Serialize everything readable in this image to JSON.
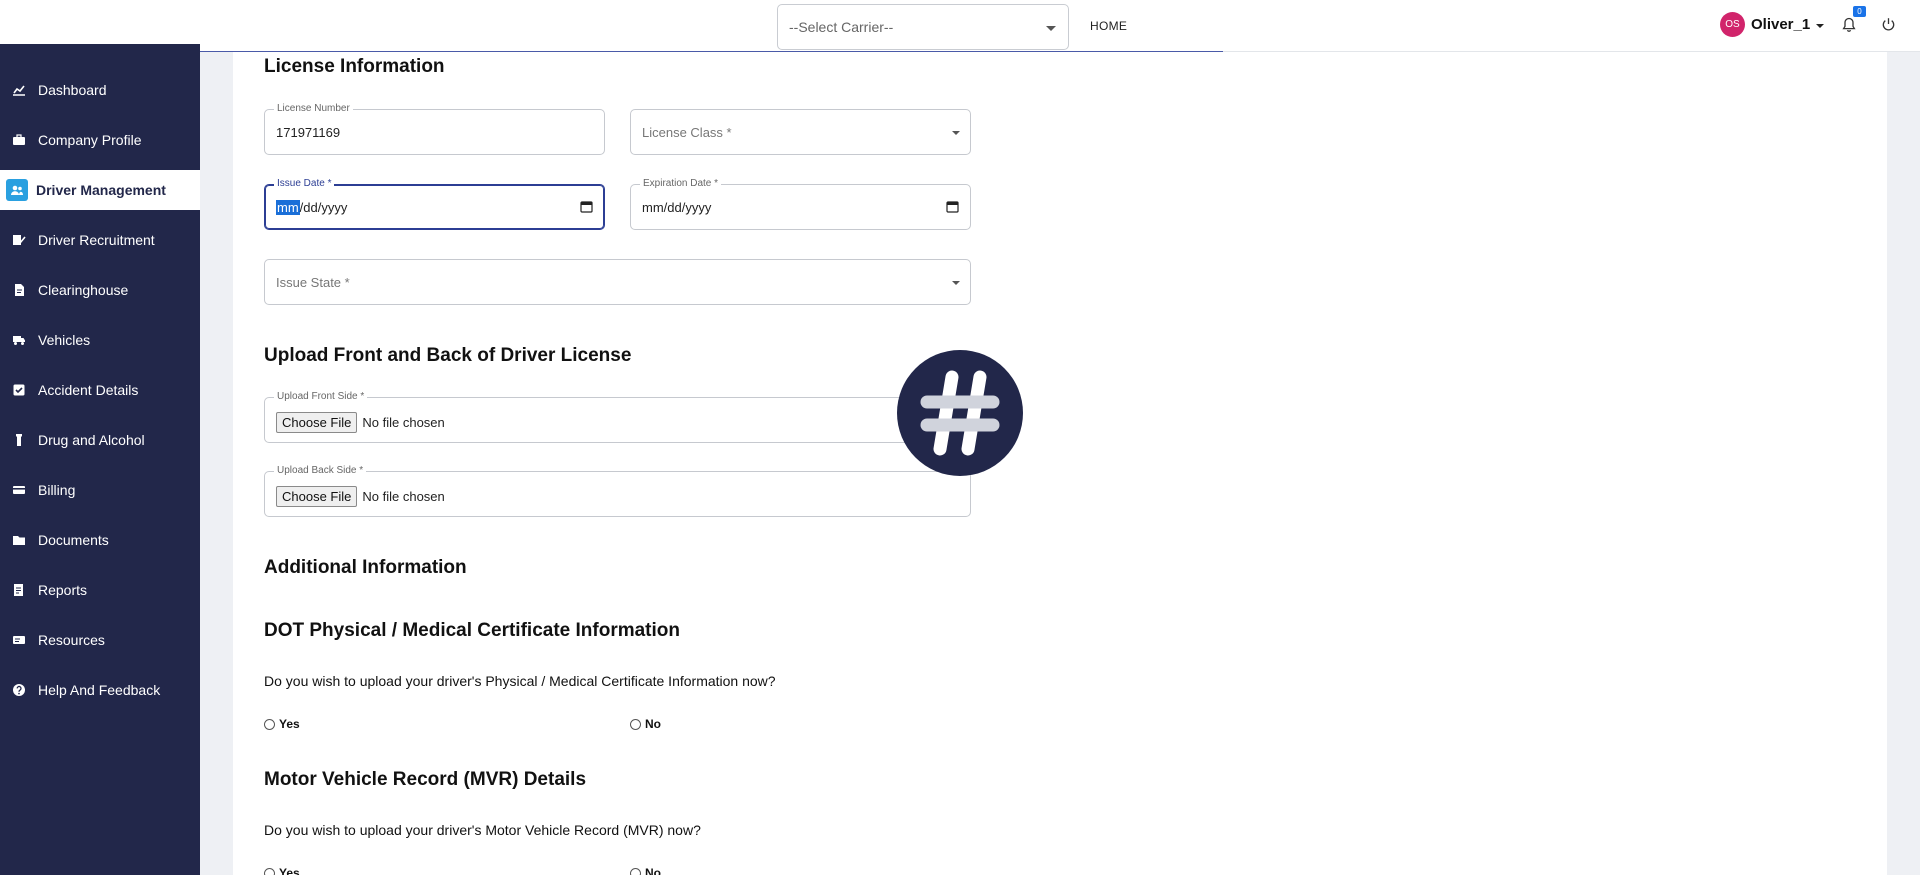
{
  "header": {
    "carrier_placeholder": "--Select Carrier--",
    "home_label": "HOME",
    "user_initials": "OS",
    "user_name": "Oliver_1",
    "notification_count": "0"
  },
  "sidebar": {
    "items": [
      {
        "label": "Dashboard",
        "icon": "chart-icon"
      },
      {
        "label": "Company Profile",
        "icon": "briefcase-icon"
      },
      {
        "label": "Driver Management",
        "icon": "users-icon",
        "active": true
      },
      {
        "label": "Driver Recruitment",
        "icon": "edit-icon"
      },
      {
        "label": "Clearinghouse",
        "icon": "document-icon"
      },
      {
        "label": "Vehicles",
        "icon": "truck-icon"
      },
      {
        "label": "Accident Details",
        "icon": "check-square-icon"
      },
      {
        "label": "Drug and Alcohol",
        "icon": "bottle-icon"
      },
      {
        "label": "Billing",
        "icon": "credit-card-icon"
      },
      {
        "label": "Documents",
        "icon": "folder-icon"
      },
      {
        "label": "Reports",
        "icon": "report-icon"
      },
      {
        "label": "Resources",
        "icon": "id-card-icon"
      },
      {
        "label": "Help And Feedback",
        "icon": "question-icon"
      }
    ]
  },
  "license": {
    "title": "License Information",
    "number_label": "License Number",
    "number_value": "171971169",
    "class_placeholder": "License Class *",
    "issue_date_label": "Issue Date *",
    "issue_date_mm": "mm",
    "issue_date_rest": "/dd/yyyy",
    "expiration_label": "Expiration Date *",
    "expiration_value": "mm/dd/yyyy",
    "state_placeholder": "Issue State *"
  },
  "upload": {
    "title": "Upload Front and Back of Driver License",
    "front_label": "Upload Front Side *",
    "back_label": "Upload Back Side *",
    "choose_file": "Choose File",
    "no_file": "No file chosen"
  },
  "additional": {
    "title": "Additional Information"
  },
  "dot": {
    "title": "DOT Physical / Medical Certificate Information",
    "question": "Do you wish to upload your driver's Physical / Medical Certificate Information now?",
    "yes": "Yes",
    "no": "No"
  },
  "mvr": {
    "title": "Motor Vehicle Record (MVR) Details",
    "question": "Do you wish to upload your driver's Motor Vehicle Record (MVR) now?",
    "yes": "Yes",
    "no": "No"
  }
}
